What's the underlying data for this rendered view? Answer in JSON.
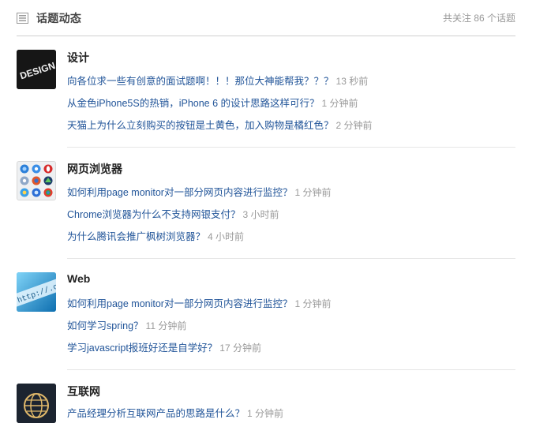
{
  "header": {
    "title": "话题动态",
    "count": "共关注 86 个话题"
  },
  "topics": [
    {
      "name": "设计",
      "thumb_text": "DESIGN",
      "questions": [
        {
          "text": "向各位求一些有创意的面试题啊！！！那位大神能帮我？？？",
          "time": "13 秒前"
        },
        {
          "text": "从金色iPhone5S的热销，iPhone 6 的设计思路这样可行？",
          "time": "1 分钟前"
        },
        {
          "text": "天猫上为什么立刻购买的按钮是土黄色，加入购物是橘红色？",
          "time": "2 分钟前"
        }
      ]
    },
    {
      "name": "网页浏览器",
      "questions": [
        {
          "text": "如何利用page monitor对一部分网页内容进行监控？",
          "time": "1 分钟前"
        },
        {
          "text": "Chrome浏览器为什么不支持网银支付？",
          "time": "3 小时前"
        },
        {
          "text": "为什么腾讯会推广枫树浏览器？",
          "time": "4 小时前"
        }
      ]
    },
    {
      "name": "Web",
      "thumb_text": "http://.com",
      "questions": [
        {
          "text": "如何利用page monitor对一部分网页内容进行监控？",
          "time": "1 分钟前"
        },
        {
          "text": "如何学习spring？",
          "time": "11 分钟前"
        },
        {
          "text": "学习javascript报班好还是自学好？",
          "time": "17 分钟前"
        }
      ]
    },
    {
      "name": "互联网",
      "questions": [
        {
          "text": "产品经理分析互联网产品的思路是什么？",
          "time": "1 分钟前"
        }
      ]
    }
  ]
}
